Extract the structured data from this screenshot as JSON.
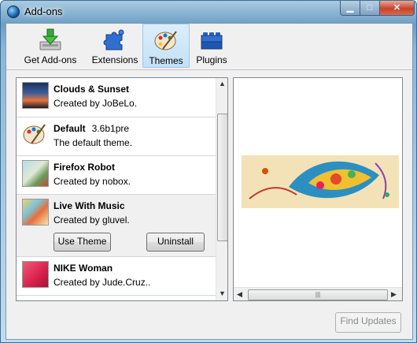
{
  "window": {
    "title": "Add-ons"
  },
  "titlebar": {
    "min_glyph": "▁",
    "max_glyph": "□",
    "close_glyph": "✕"
  },
  "toolbar": {
    "items": [
      {
        "label": "Get Add-ons",
        "icon": "get-addons-icon"
      },
      {
        "label": "Extensions",
        "icon": "puzzle-piece-icon"
      },
      {
        "label": "Themes",
        "icon": "palette-icon",
        "selected": true
      },
      {
        "label": "Plugins",
        "icon": "lego-blocks-icon"
      }
    ]
  },
  "themes": [
    {
      "name": "Clouds & Sunset",
      "version": "",
      "description": "Created by JoBeLo."
    },
    {
      "name": "Default",
      "version": "3.6b1pre",
      "description": "The default theme."
    },
    {
      "name": "Firefox Robot",
      "version": "",
      "description": "Created by nobox."
    },
    {
      "name": "Live With Music",
      "version": "",
      "description": "Created by gluvel.",
      "selected": true
    },
    {
      "name": "NIKE Woman",
      "version": "",
      "description": "Created by Jude.Cruz.."
    }
  ],
  "selected_actions": {
    "use_theme_label": "Use Theme",
    "uninstall_label": "Uninstall"
  },
  "footer": {
    "find_updates_label": "Find Updates"
  },
  "colors": {
    "selection_bg": "#c4e0f7",
    "title_bar": "#6d9ec4",
    "close_button": "#c7422c"
  }
}
